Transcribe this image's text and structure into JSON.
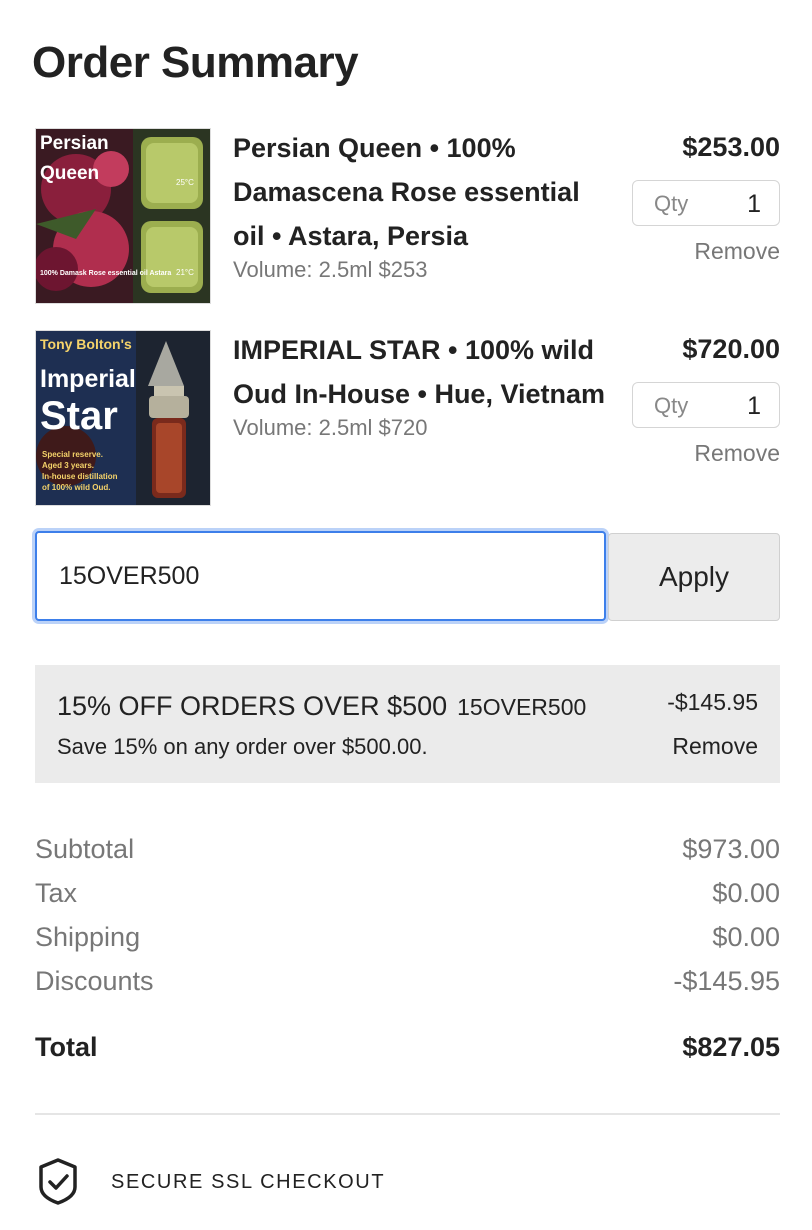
{
  "header": {
    "title": "Order Summary"
  },
  "items": [
    {
      "name": "Persian Queen • 100% Damascena Rose essential oil • Astara, Persia",
      "volume": "Volume: 2.5ml $253",
      "price": "$253.00",
      "qty_label": "Qty",
      "qty": "1",
      "remove_label": "Remove",
      "thumb_text": {
        "brand": "Persian",
        "line2": "Queen",
        "temp1": "25°C",
        "temp2": "21°C",
        "desc": "100% Damask Rose essential oil Astara"
      }
    },
    {
      "name": "IMPERIAL STAR • 100% wild Oud In-House • Hue, Vietnam",
      "volume": "Volume: 2.5ml $720",
      "price": "$720.00",
      "qty_label": "Qty",
      "qty": "1",
      "remove_label": "Remove",
      "thumb_text": {
        "brand": "Tony Bolton's",
        "line2": "Imperial",
        "line3": "Star",
        "desc1": "Special reserve.",
        "desc2": "Aged 3 years.",
        "desc3": "In-house distillation",
        "desc4": "of 100% wild Oud."
      }
    }
  ],
  "coupon": {
    "value": "15OVER500",
    "apply_label": "Apply"
  },
  "discount": {
    "name": "15% OFF ORDERS OVER $500",
    "code": "15OVER500",
    "description": "Save 15% on any order over $500.00.",
    "amount": "-$145.95",
    "remove_label": "Remove"
  },
  "totals": {
    "rows": [
      {
        "label": "Subtotal",
        "value": "$973.00"
      },
      {
        "label": "Tax",
        "value": "$0.00"
      },
      {
        "label": "Shipping",
        "value": "$0.00"
      },
      {
        "label": "Discounts",
        "value": "-$145.95"
      }
    ],
    "total_label": "Total",
    "total_value": "$827.05"
  },
  "secure": {
    "label": "SECURE SSL CHECKOUT"
  },
  "colors": {
    "focus_ring": "#3d7fea",
    "discount_bg": "#ebebeb",
    "muted_text": "#777777",
    "text": "#222222"
  }
}
